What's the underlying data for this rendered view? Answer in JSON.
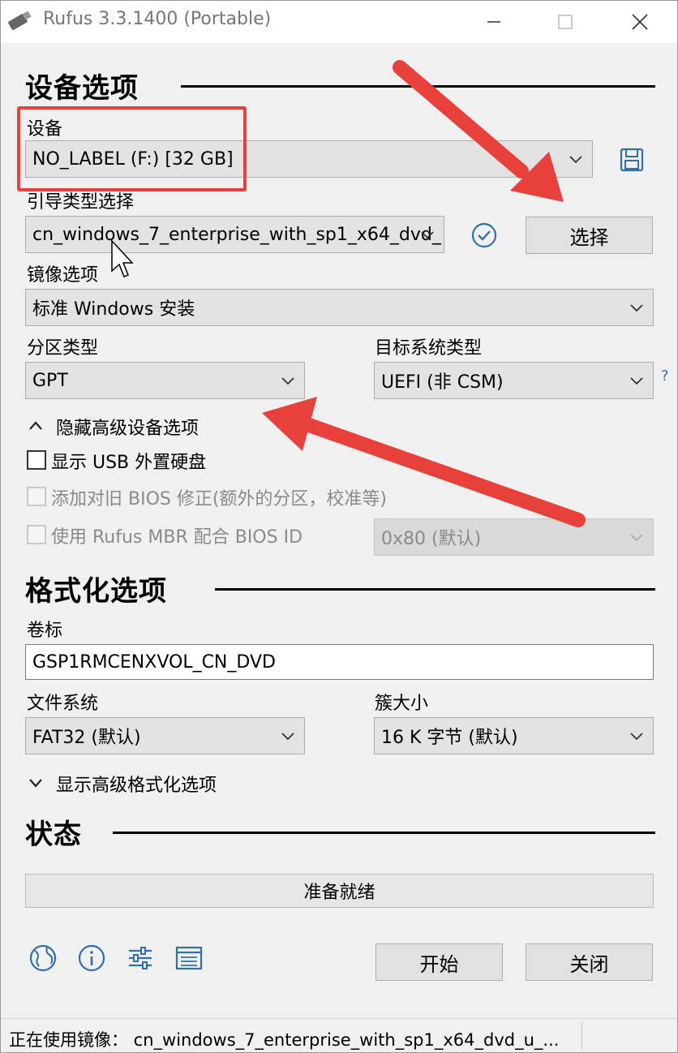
{
  "window": {
    "title": "Rufus 3.3.1400 (Portable)"
  },
  "device_section": {
    "title": "设备选项",
    "device_label": "设备",
    "device_value": "NO_LABEL (F:) [32 GB]",
    "boot_label": "引导类型选择",
    "boot_value": "cn_windows_7_enterprise_with_sp1_x64_dvd_",
    "select_button": "选择",
    "image_option_label": "镜像选项",
    "image_option_value": "标准 Windows 安装",
    "partition_label": "分区类型",
    "partition_value": "GPT",
    "target_label": "目标系统类型",
    "target_value": "UEFI (非 CSM)",
    "help_mark": "?",
    "advanced_toggle": "隐藏高级设备选项",
    "show_usb_label": "显示 USB 外置硬盘",
    "old_bios_label": "添加对旧 BIOS 修正(额外的分区，校准等)",
    "rufus_mbr_label": "使用 Rufus MBR 配合 BIOS ID",
    "bios_id_value": "0x80 (默认)"
  },
  "format_section": {
    "title": "格式化选项",
    "volume_label": "卷标",
    "volume_value": "GSP1RMCENXVOL_CN_DVD",
    "fs_label": "文件系统",
    "fs_value": "FAT32 (默认)",
    "cluster_label": "簇大小",
    "cluster_value": "16 K 字节 (默认)",
    "advanced_toggle": "显示高级格式化选项"
  },
  "status_section": {
    "title": "状态",
    "progress_text": "准备就绪",
    "progress": 0,
    "start_button": "开始",
    "close_button": "关闭"
  },
  "statusbar": {
    "text": "正在使用镜像： cn_windows_7_enterprise_with_sp1_x64_dvd_u_..."
  },
  "toolbar_icons": [
    "globe-icon",
    "info-icon",
    "settings-sliders-icon",
    "log-icon"
  ],
  "colors": {
    "annotation_red": "#e8403a",
    "window_bg": "#f0f0f0",
    "accent_blue": "#1e73be"
  }
}
